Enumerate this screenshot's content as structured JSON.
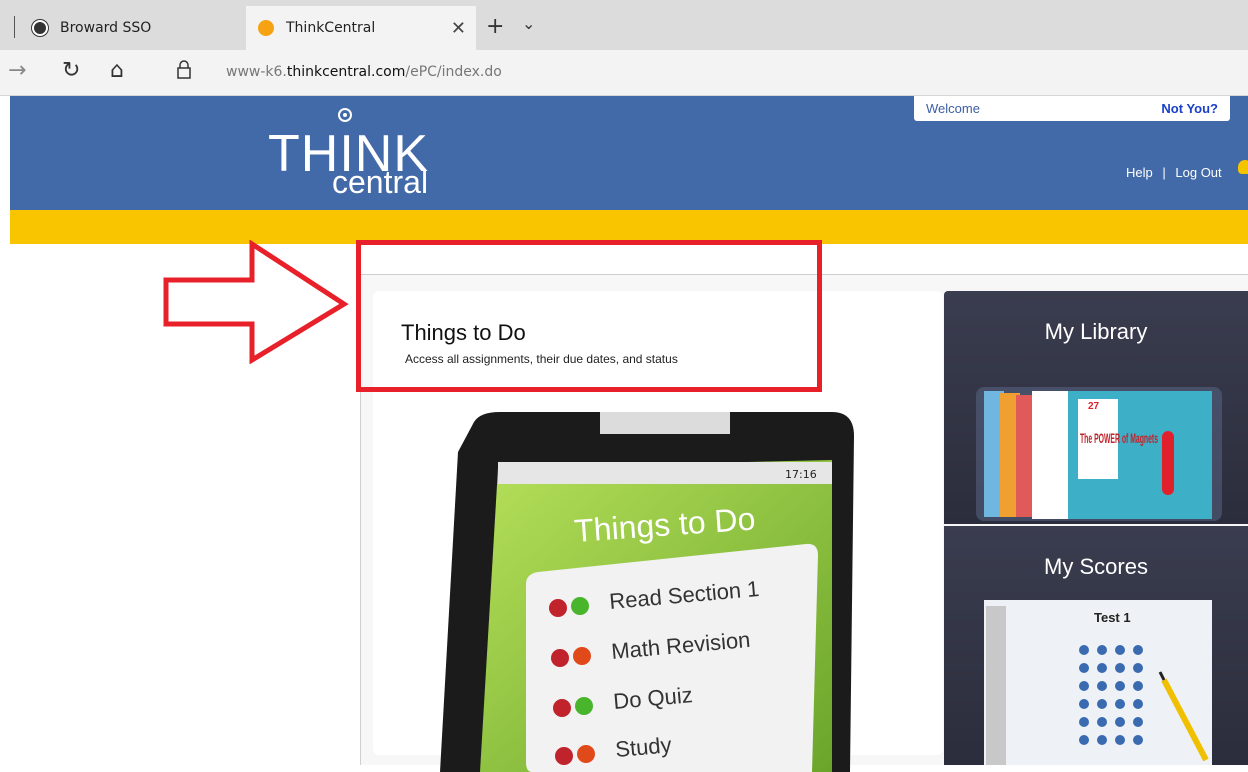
{
  "browser": {
    "tabs": [
      {
        "title": "Broward SSO",
        "active": false,
        "icon": "broward-logo-icon"
      },
      {
        "title": "ThinkCentral",
        "active": true,
        "icon": "orange-dot-icon"
      }
    ],
    "url_prefix": "www-k6.",
    "url_host": "thinkcentral.com",
    "url_path": "/ePC/index.do"
  },
  "header": {
    "logo_think": "THINK",
    "logo_central": "central",
    "welcome_label": "Welcome",
    "not_you_link": "Not You?",
    "help_link": "Help",
    "separator": "|",
    "logout_link": "Log Out"
  },
  "main": {
    "things_title": "Things to Do",
    "things_subtitle": "Access all assignments, their due dates, and status",
    "tablet": {
      "time": "17:16",
      "title": "Things to Do",
      "items": [
        "Read Section 1",
        "Math Revision",
        "Do Quiz",
        "Study"
      ]
    }
  },
  "sidebar": {
    "library_title": "My Library",
    "library_book_title": "The POWER of Magnets",
    "library_book_page": "27",
    "scores_title": "My Scores",
    "scores_test_title": "Test 1"
  },
  "colors": {
    "header_blue": "#4269a8",
    "accent_yellow": "#f9c500",
    "highlight_red": "#e8202a",
    "tablet_green": "#8cc63f"
  }
}
